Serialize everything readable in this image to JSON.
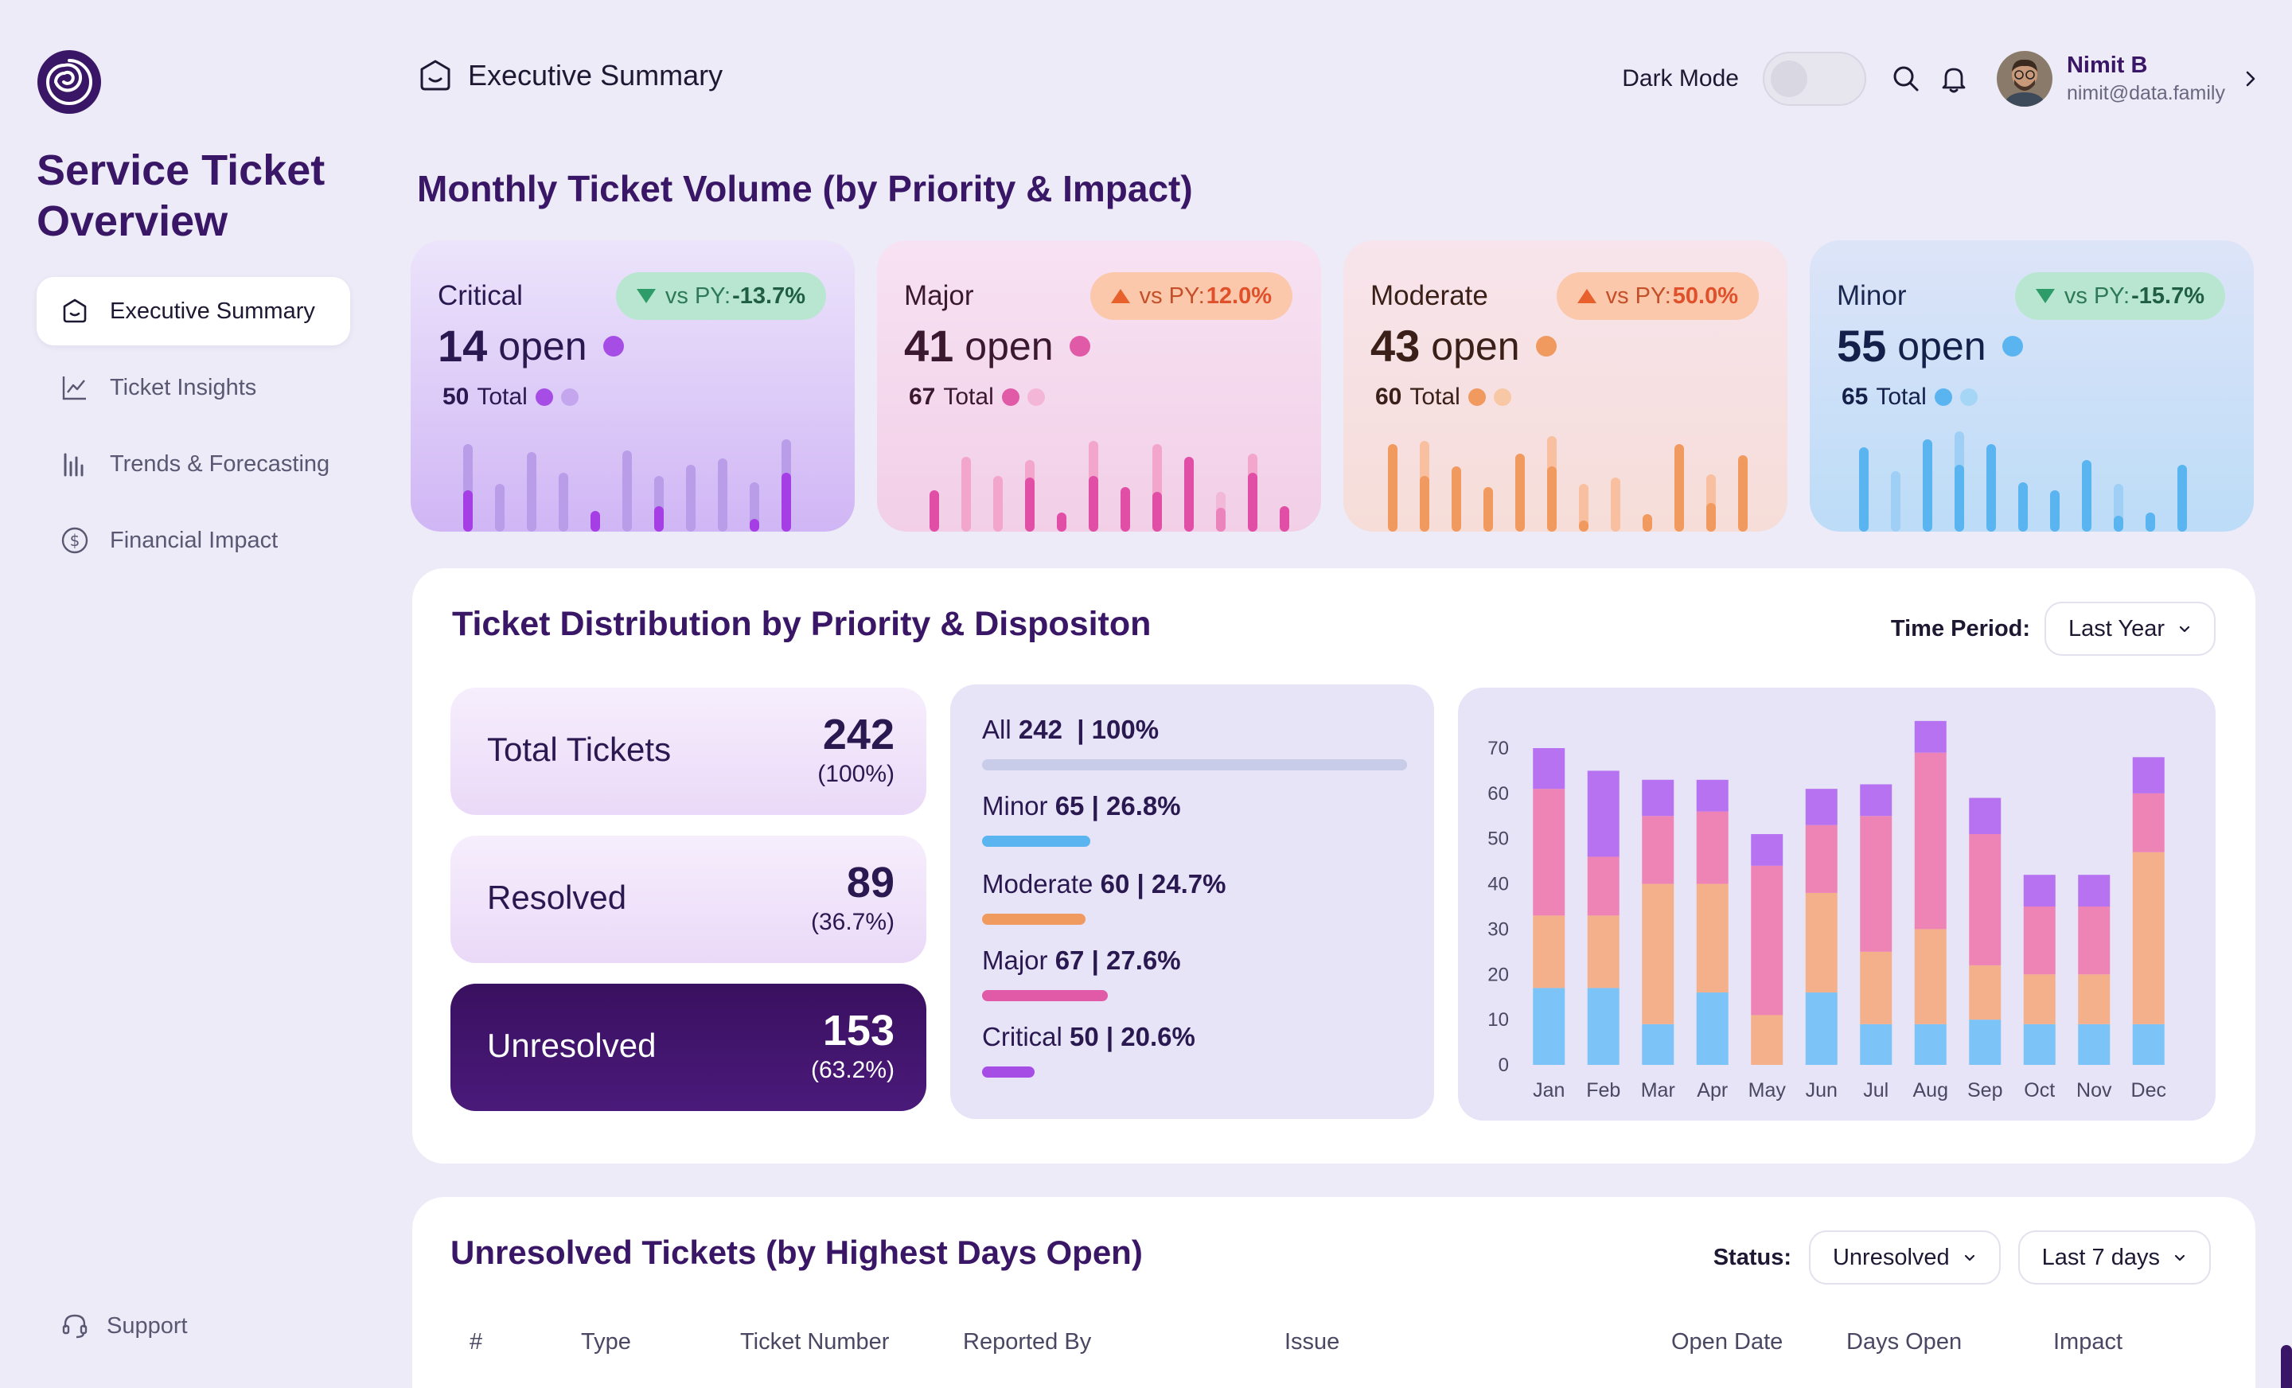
{
  "sidebar": {
    "title": "Service Ticket Overview",
    "nav": [
      {
        "label": "Executive Summary",
        "icon": "home-icon",
        "active": true
      },
      {
        "label": "Ticket Insights",
        "icon": "line-chart-icon",
        "active": false
      },
      {
        "label": "Trends & Forecasting",
        "icon": "bar-chart-icon",
        "active": false
      },
      {
        "label": "Financial Impact",
        "icon": "dollar-circle-icon",
        "active": false
      }
    ],
    "support_label": "Support"
  },
  "header": {
    "page_title": "Executive Summary",
    "dark_mode_label": "Dark Mode",
    "user_name": "Nimit B",
    "user_email": "nimit@data.family"
  },
  "monthly": {
    "title": "Monthly Ticket Volume (by Priority & Impact)",
    "cards": [
      {
        "name": "Critical",
        "open": "14",
        "open_label": "open",
        "total": "50",
        "total_label": "Total",
        "vs_label": "vs PY:",
        "vs_value": "-13.7%",
        "trend": "down",
        "color": "#a64de6"
      },
      {
        "name": "Major",
        "open": "41",
        "open_label": "open",
        "total": "67",
        "total_label": "Total",
        "vs_label": "vs PY:",
        "vs_value": "12.0%",
        "trend": "up",
        "color": "#e05aa8"
      },
      {
        "name": "Moderate",
        "open": "43",
        "open_label": "open",
        "total": "60",
        "total_label": "Total",
        "vs_label": "vs PY:",
        "vs_value": "50.0%",
        "trend": "up",
        "color": "#f09a60"
      },
      {
        "name": "Minor",
        "open": "55",
        "open_label": "open",
        "total": "65",
        "total_label": "Total",
        "vs_label": "vs PY:",
        "vs_value": "-15.7%",
        "trend": "down",
        "color": "#5ab4f0"
      }
    ]
  },
  "distribution": {
    "title": "Ticket Distribution by Priority & Dispositon",
    "time_period_label": "Time Period:",
    "time_period_value": "Last Year",
    "stats": [
      {
        "label": "Total Tickets",
        "value": "242",
        "pct": "(100%)"
      },
      {
        "label": "Resolved",
        "value": "89",
        "pct": "(36.7%)"
      },
      {
        "label": "Unresolved",
        "value": "153",
        "pct": "(63.2%)"
      }
    ],
    "breakdown": [
      {
        "name": "All",
        "count": "242",
        "pct": "| 100%",
        "fraction": 1.0,
        "color": "#c8cce8"
      },
      {
        "name": "Minor",
        "count": "65",
        "pct": "| 26.8%",
        "fraction": 0.268,
        "color": "#5ab4f0"
      },
      {
        "name": "Moderate",
        "count": "60",
        "pct": "| 24.7%",
        "fraction": 0.247,
        "color": "#f09a60"
      },
      {
        "name": "Major",
        "count": "67",
        "pct": "| 27.6%",
        "fraction": 0.276,
        "color": "#e05aa8"
      },
      {
        "name": "Critical",
        "count": "50",
        "pct": "| 20.6%",
        "fraction": 0.206,
        "color": "#a64de6"
      }
    ]
  },
  "chart_data": {
    "type": "bar",
    "stacked": true,
    "categories": [
      "Jan",
      "Feb",
      "Mar",
      "Apr",
      "May",
      "Jun",
      "Jul",
      "Aug",
      "Sep",
      "Oct",
      "Nov",
      "Dec"
    ],
    "ylim": [
      0,
      70
    ],
    "yticks": [
      "0",
      "10",
      "20",
      "30",
      "40",
      "50",
      "60",
      "70"
    ],
    "grid": false,
    "series": [
      {
        "color": "#7cc4f7",
        "values": [
          17,
          17,
          9,
          16,
          0,
          16,
          9,
          9,
          10,
          9,
          9,
          9
        ]
      },
      {
        "color": "#f4b08a",
        "values": [
          16,
          16,
          31,
          24,
          11,
          22,
          16,
          21,
          12,
          11,
          11,
          38
        ]
      },
      {
        "color": "#ee84b6",
        "values": [
          28,
          13,
          15,
          16,
          33,
          15,
          30,
          39,
          29,
          15,
          15,
          13
        ]
      },
      {
        "color": "#b772f2",
        "values": [
          9,
          19,
          8,
          7,
          7,
          8,
          7,
          7,
          8,
          7,
          7,
          8
        ]
      }
    ]
  },
  "unresolved": {
    "title": "Unresolved Tickets (by Highest Days Open)",
    "status_label": "Status:",
    "status_value": "Unresolved",
    "range_value": "Last 7 days",
    "columns": [
      "#",
      "Type",
      "Ticket Number",
      "Reported By",
      "Issue",
      "Open Date",
      "Days Open",
      "Impact"
    ]
  }
}
